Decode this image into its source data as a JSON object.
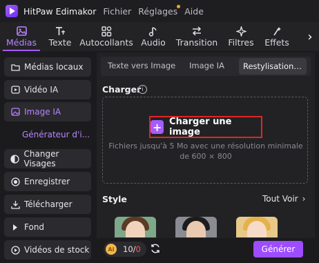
{
  "app": {
    "title": "HitPaw Edimakor",
    "menu": [
      "Fichier",
      "Réglages",
      "Aide"
    ]
  },
  "toolbar": {
    "tabs": [
      {
        "label": "Médias",
        "icon": "media-icon",
        "active": true
      },
      {
        "label": "Texte",
        "icon": "text-icon",
        "active": false
      },
      {
        "label": "Autocollants",
        "icon": "stickers-icon",
        "active": false
      },
      {
        "label": "Audio",
        "icon": "audio-icon",
        "active": false
      },
      {
        "label": "Transition",
        "icon": "transition-icon",
        "active": false
      },
      {
        "label": "Filtres",
        "icon": "filters-icon",
        "active": false
      },
      {
        "label": "Effets",
        "icon": "effects-icon",
        "active": false
      }
    ],
    "next_icon": "chevron-right-icon"
  },
  "sidebar": {
    "items": [
      {
        "label": "Médias locaux",
        "icon": "folder-icon"
      },
      {
        "label": "Vidéo IA",
        "icon": "video-ai-icon"
      },
      {
        "label": "Image IA",
        "icon": "image-ai-icon",
        "active": true
      },
      {
        "label": "Changer Visages",
        "icon": "face-swap-icon"
      },
      {
        "label": "Enregistrer",
        "icon": "record-icon"
      },
      {
        "label": "Télécharger",
        "icon": "download-icon"
      },
      {
        "label": "Fond",
        "icon": "play-icon"
      },
      {
        "label": "Vidéos de stock",
        "icon": "stock-video-icon"
      }
    ],
    "sub_item": "Générateur d'i..."
  },
  "main": {
    "subtabs": [
      "Texte vers Image",
      "Image IA",
      "Restylisation d'..."
    ],
    "upload_section_label": "Charger",
    "upload_button_label": "Charger une image",
    "upload_hint": "Fichiers jusqu'à 5 Mo avec une résolution minimale de 600 × 800",
    "style_section_label": "Style",
    "see_all_label": "Tout Voir"
  },
  "bottom": {
    "credits_used": "10",
    "credits_separator": "/",
    "credits_remaining": "0",
    "generate_label": "Générer"
  },
  "colors": {
    "accent": "#a45cff",
    "highlight_border": "#e02626"
  }
}
